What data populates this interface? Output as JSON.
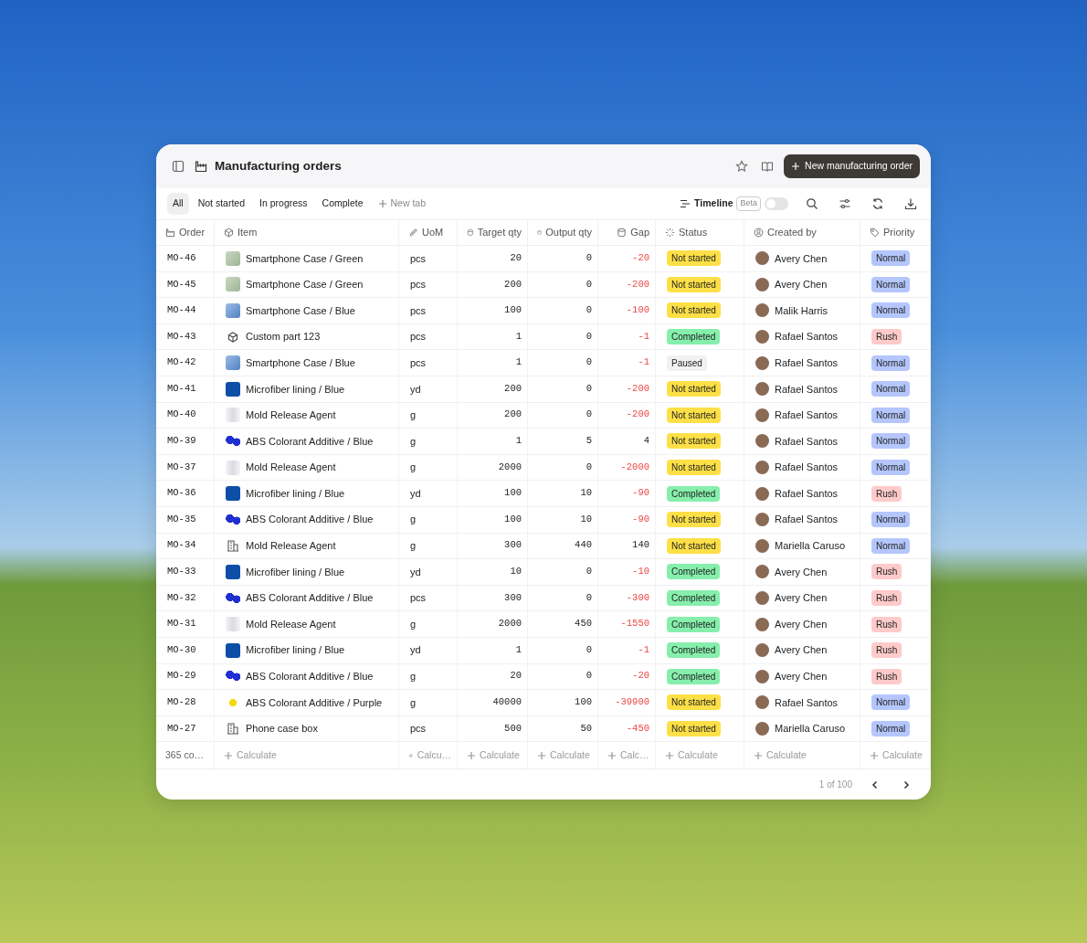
{
  "header": {
    "title": "Manufacturing orders",
    "new_button": "New manufacturing order"
  },
  "tabs": [
    {
      "label": "All",
      "selected": true
    },
    {
      "label": "Not started",
      "selected": false
    },
    {
      "label": "In progress",
      "selected": false
    },
    {
      "label": "Complete",
      "selected": false
    }
  ],
  "new_tab": "New tab",
  "timeline": {
    "label": "Timeline",
    "badge": "Beta",
    "on": false
  },
  "table": {
    "columns": [
      {
        "label": "Order",
        "kind": "factory"
      },
      {
        "label": "Item",
        "kind": "cube"
      },
      {
        "label": "UoM",
        "kind": "ruler"
      },
      {
        "label": "Target qty",
        "kind": "db"
      },
      {
        "label": "Output qty",
        "kind": "db"
      },
      {
        "label": "Gap",
        "kind": "db"
      },
      {
        "label": "Status",
        "kind": "loader"
      },
      {
        "label": "Created by",
        "kind": "user"
      },
      {
        "label": "Priority",
        "kind": "tag"
      }
    ],
    "rows": [
      {
        "order": "MO-46",
        "item": {
          "label": "Smartphone Case / Green",
          "kind": "greencase"
        },
        "uom": "pcs",
        "target": "20",
        "output": "0",
        "gap": "-20",
        "negative": true,
        "status": {
          "label": "Not started",
          "kind": "notstarted"
        },
        "created_by": "Avery Chen",
        "priority": {
          "label": "Normal",
          "kind": "normal"
        }
      },
      {
        "order": "MO-45",
        "item": {
          "label": "Smartphone Case / Green",
          "kind": "greencase"
        },
        "uom": "pcs",
        "target": "200",
        "output": "0",
        "gap": "-200",
        "negative": true,
        "status": {
          "label": "Not started",
          "kind": "notstarted"
        },
        "created_by": "Avery Chen",
        "priority": {
          "label": "Normal",
          "kind": "normal"
        }
      },
      {
        "order": "MO-44",
        "item": {
          "label": "Smartphone Case / Blue",
          "kind": "bluecase"
        },
        "uom": "pcs",
        "target": "100",
        "output": "0",
        "gap": "-100",
        "negative": true,
        "status": {
          "label": "Not started",
          "kind": "notstarted"
        },
        "created_by": "Malik Harris",
        "priority": {
          "label": "Normal",
          "kind": "normal"
        }
      },
      {
        "order": "MO-43",
        "item": {
          "label": "Custom part 123",
          "kind": "cube"
        },
        "uom": "pcs",
        "target": "1",
        "output": "0",
        "gap": "-1",
        "negative": true,
        "status": {
          "label": "Completed",
          "kind": "completed"
        },
        "created_by": "Rafael Santos",
        "priority": {
          "label": "Rush",
          "kind": "rush"
        }
      },
      {
        "order": "MO-42",
        "item": {
          "label": "Smartphone Case / Blue",
          "kind": "bluecase"
        },
        "uom": "pcs",
        "target": "1",
        "output": "0",
        "gap": "-1",
        "negative": true,
        "status": {
          "label": "Paused",
          "kind": "paused"
        },
        "created_by": "Rafael Santos",
        "priority": {
          "label": "Normal",
          "kind": "normal"
        }
      },
      {
        "order": "MO-41",
        "item": {
          "label": "Microfiber lining / Blue",
          "kind": "swatch"
        },
        "uom": "yd",
        "target": "200",
        "output": "0",
        "gap": "-200",
        "negative": true,
        "status": {
          "label": "Not started",
          "kind": "notstarted"
        },
        "created_by": "Rafael Santos",
        "priority": {
          "label": "Normal",
          "kind": "normal"
        }
      },
      {
        "order": "MO-40",
        "item": {
          "label": "Mold Release Agent",
          "kind": "bottle"
        },
        "uom": "g",
        "target": "200",
        "output": "0",
        "gap": "-200",
        "negative": true,
        "status": {
          "label": "Not started",
          "kind": "notstarted"
        },
        "created_by": "Rafael Santos",
        "priority": {
          "label": "Normal",
          "kind": "normal"
        }
      },
      {
        "order": "MO-39",
        "item": {
          "label": "ABS Colorant Additive / Blue",
          "kind": "pellets"
        },
        "uom": "g",
        "target": "1",
        "output": "5",
        "gap": "4",
        "negative": false,
        "status": {
          "label": "Not started",
          "kind": "notstarted"
        },
        "created_by": "Rafael Santos",
        "priority": {
          "label": "Normal",
          "kind": "normal"
        }
      },
      {
        "order": "MO-37",
        "item": {
          "label": "Mold Release Agent",
          "kind": "bottle"
        },
        "uom": "g",
        "target": "2000",
        "output": "0",
        "gap": "-2000",
        "negative": true,
        "status": {
          "label": "Not started",
          "kind": "notstarted"
        },
        "created_by": "Rafael Santos",
        "priority": {
          "label": "Normal",
          "kind": "normal"
        }
      },
      {
        "order": "MO-36",
        "item": {
          "label": "Microfiber lining / Blue",
          "kind": "swatch"
        },
        "uom": "yd",
        "target": "100",
        "output": "10",
        "gap": "-90",
        "negative": true,
        "status": {
          "label": "Completed",
          "kind": "completed"
        },
        "created_by": "Rafael Santos",
        "priority": {
          "label": "Rush",
          "kind": "rush"
        }
      },
      {
        "order": "MO-35",
        "item": {
          "label": "ABS Colorant Additive / Blue",
          "kind": "pellets"
        },
        "uom": "g",
        "target": "100",
        "output": "10",
        "gap": "-90",
        "negative": true,
        "status": {
          "label": "Not started",
          "kind": "notstarted"
        },
        "created_by": "Rafael Santos",
        "priority": {
          "label": "Normal",
          "kind": "normal"
        }
      },
      {
        "order": "MO-34",
        "item": {
          "label": "Mold Release Agent",
          "kind": "building"
        },
        "uom": "g",
        "target": "300",
        "output": "440",
        "gap": "140",
        "negative": false,
        "status": {
          "label": "Not started",
          "kind": "notstarted"
        },
        "created_by": "Mariella Caruso",
        "priority": {
          "label": "Normal",
          "kind": "normal"
        }
      },
      {
        "order": "MO-33",
        "item": {
          "label": "Microfiber lining / Blue",
          "kind": "swatch"
        },
        "uom": "yd",
        "target": "10",
        "output": "0",
        "gap": "-10",
        "negative": true,
        "status": {
          "label": "Completed",
          "kind": "completed"
        },
        "created_by": "Avery Chen",
        "priority": {
          "label": "Rush",
          "kind": "rush"
        }
      },
      {
        "order": "MO-32",
        "item": {
          "label": "ABS Colorant Additive / Blue",
          "kind": "pellets"
        },
        "uom": "pcs",
        "target": "300",
        "output": "0",
        "gap": "-300",
        "negative": true,
        "status": {
          "label": "Completed",
          "kind": "completed"
        },
        "created_by": "Avery Chen",
        "priority": {
          "label": "Rush",
          "kind": "rush"
        }
      },
      {
        "order": "MO-31",
        "item": {
          "label": "Mold Release Agent",
          "kind": "bottle"
        },
        "uom": "g",
        "target": "2000",
        "output": "450",
        "gap": "-1550",
        "negative": true,
        "status": {
          "label": "Completed",
          "kind": "completed"
        },
        "created_by": "Avery Chen",
        "priority": {
          "label": "Rush",
          "kind": "rush"
        }
      },
      {
        "order": "MO-30",
        "item": {
          "label": "Microfiber lining / Blue",
          "kind": "swatch"
        },
        "uom": "yd",
        "target": "1",
        "output": "0",
        "gap": "-1",
        "negative": true,
        "status": {
          "label": "Completed",
          "kind": "completed"
        },
        "created_by": "Avery Chen",
        "priority": {
          "label": "Rush",
          "kind": "rush"
        }
      },
      {
        "order": "MO-29",
        "item": {
          "label": "ABS Colorant Additive / Blue",
          "kind": "pellets"
        },
        "uom": "g",
        "target": "20",
        "output": "0",
        "gap": "-20",
        "negative": true,
        "status": {
          "label": "Completed",
          "kind": "completed"
        },
        "created_by": "Avery Chen",
        "priority": {
          "label": "Rush",
          "kind": "rush"
        }
      },
      {
        "order": "MO-28",
        "item": {
          "label": "ABS Colorant Additive / Purple",
          "kind": "pellet"
        },
        "uom": "g",
        "target": "40000",
        "output": "100",
        "gap": "-39900",
        "negative": true,
        "status": {
          "label": "Not started",
          "kind": "notstarted"
        },
        "created_by": "Rafael Santos",
        "priority": {
          "label": "Normal",
          "kind": "normal"
        }
      },
      {
        "order": "MO-27",
        "item": {
          "label": "Phone case box",
          "kind": "building"
        },
        "uom": "pcs",
        "target": "500",
        "output": "50",
        "gap": "-450",
        "negative": true,
        "status": {
          "label": "Not started",
          "kind": "notstarted"
        },
        "created_by": "Mariella Caruso",
        "priority": {
          "label": "Normal",
          "kind": "normal"
        }
      }
    ],
    "footer": [
      "365 co…",
      "Calculate",
      "Calcu…",
      "Calculate",
      "Calculate",
      "Calc…",
      "Calculate",
      "Calculate",
      "Calculate"
    ]
  },
  "pagination": {
    "label": "1 of 100"
  }
}
